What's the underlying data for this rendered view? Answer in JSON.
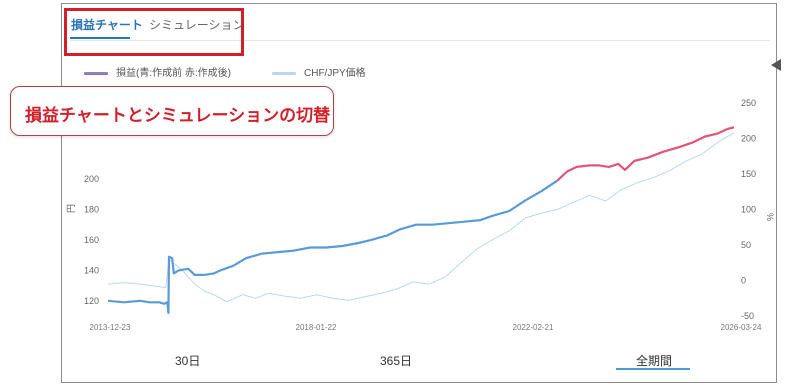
{
  "tabs": [
    {
      "label": "損益チャート",
      "active": true
    },
    {
      "label": "シミュレーション",
      "active": false
    }
  ],
  "legend": {
    "pnl_label": "損益(青:作成前 赤:作成後)",
    "price_label": "CHF/JPY価格"
  },
  "callout": {
    "text": "損益チャートとシミュレーションの切替"
  },
  "range_tabs": [
    {
      "label": "30日",
      "selected": false
    },
    {
      "label": "365日",
      "selected": false
    },
    {
      "label": "全期間",
      "selected": true
    }
  ],
  "colors": {
    "pnl_before": "#5b9bd5",
    "pnl_after": "#e05577",
    "price": "#bcd7ef",
    "accent": "#2c74b8",
    "callout_red": "#d0202a"
  },
  "chart_data": {
    "type": "line",
    "left_axis": {
      "label": "円",
      "ticks": [
        120,
        140,
        160,
        180,
        200
      ],
      "range": [
        110,
        250
      ]
    },
    "right_axis": {
      "label": "%",
      "ticks": [
        250,
        200,
        150,
        100,
        50,
        0,
        -50
      ],
      "range": [
        -50,
        250
      ]
    },
    "x_ticks": [
      "2013-12-23",
      "2018-01-22",
      "2022-02-21",
      "2026-03-24"
    ],
    "series": [
      {
        "name": "損益(青:作成前 赤:作成後)",
        "axis": "left",
        "segments": [
          {
            "color": "before",
            "points": [
              [
                0,
                120
              ],
              [
                0.5,
                119
              ],
              [
                1.0,
                120
              ],
              [
                1.3,
                119
              ],
              [
                1.6,
                119
              ],
              [
                1.75,
                118
              ],
              [
                1.85,
                119
              ],
              [
                1.88,
                112
              ],
              [
                1.9,
                149
              ],
              [
                2.0,
                148
              ],
              [
                2.05,
                138
              ],
              [
                2.2,
                140
              ],
              [
                2.5,
                141
              ],
              [
                2.7,
                137
              ],
              [
                3.0,
                137
              ],
              [
                3.3,
                138
              ],
              [
                3.5,
                140
              ],
              [
                3.9,
                143
              ],
              [
                4.3,
                148
              ],
              [
                4.8,
                151
              ],
              [
                5.3,
                152
              ],
              [
                5.8,
                153
              ],
              [
                6.3,
                155
              ],
              [
                6.8,
                155
              ],
              [
                7.3,
                156
              ],
              [
                7.8,
                158
              ],
              [
                8.2,
                160
              ],
              [
                8.7,
                163
              ],
              [
                9.1,
                167
              ],
              [
                9.6,
                170
              ],
              [
                10.1,
                170
              ],
              [
                10.6,
                171
              ],
              [
                11.1,
                172
              ],
              [
                11.6,
                173
              ],
              [
                12.0,
                176
              ],
              [
                12.5,
                179
              ],
              [
                13.0,
                186
              ],
              [
                13.5,
                192
              ],
              [
                14.0,
                199
              ]
            ]
          },
          {
            "color": "after",
            "points": [
              [
                14.0,
                199
              ],
              [
                14.3,
                205
              ],
              [
                14.6,
                208
              ],
              [
                15.0,
                209
              ],
              [
                15.3,
                209
              ],
              [
                15.6,
                208
              ],
              [
                15.9,
                210
              ],
              [
                16.1,
                206
              ],
              [
                16.4,
                212
              ],
              [
                16.8,
                214
              ],
              [
                17.3,
                218
              ],
              [
                17.8,
                221
              ],
              [
                18.2,
                224
              ],
              [
                18.6,
                228
              ],
              [
                19.0,
                230
              ],
              [
                19.3,
                233
              ],
              [
                19.5,
                234
              ]
            ]
          }
        ]
      },
      {
        "name": "CHF/JPY価格",
        "axis": "right",
        "points": [
          [
            0,
            -5
          ],
          [
            0.5,
            -3
          ],
          [
            1.0,
            -5
          ],
          [
            1.5,
            -8
          ],
          [
            1.8,
            -10
          ],
          [
            1.9,
            30
          ],
          [
            2.0,
            26
          ],
          [
            2.3,
            15
          ],
          [
            2.7,
            -5
          ],
          [
            3.0,
            -15
          ],
          [
            3.3,
            -20
          ],
          [
            3.7,
            -30
          ],
          [
            4.2,
            -20
          ],
          [
            4.6,
            -25
          ],
          [
            5.0,
            -18
          ],
          [
            5.5,
            -22
          ],
          [
            6.0,
            -25
          ],
          [
            6.5,
            -20
          ],
          [
            7.0,
            -25
          ],
          [
            7.5,
            -28
          ],
          [
            8.0,
            -23
          ],
          [
            8.5,
            -18
          ],
          [
            9.0,
            -12
          ],
          [
            9.5,
            -2
          ],
          [
            10.0,
            -5
          ],
          [
            10.5,
            5
          ],
          [
            11.0,
            25
          ],
          [
            11.5,
            45
          ],
          [
            12.0,
            58
          ],
          [
            12.5,
            70
          ],
          [
            13.0,
            88
          ],
          [
            13.5,
            95
          ],
          [
            14.0,
            100
          ],
          [
            14.5,
            110
          ],
          [
            15.0,
            120
          ],
          [
            15.5,
            112
          ],
          [
            16.0,
            128
          ],
          [
            16.5,
            138
          ],
          [
            17.0,
            145
          ],
          [
            17.5,
            155
          ],
          [
            18.0,
            168
          ],
          [
            18.5,
            178
          ],
          [
            19.0,
            195
          ],
          [
            19.5,
            208
          ]
        ]
      }
    ]
  }
}
